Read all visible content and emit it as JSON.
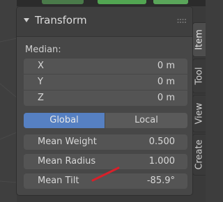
{
  "panel": {
    "title": "Transform"
  },
  "median": {
    "label": "Median:",
    "fields": [
      {
        "label": "X",
        "value": "0 m"
      },
      {
        "label": "Y",
        "value": "0 m"
      },
      {
        "label": "Z",
        "value": "0 m"
      }
    ]
  },
  "space_toggle": {
    "options": [
      "Global",
      "Local"
    ],
    "selected": "Global"
  },
  "properties": [
    {
      "label": "Mean Weight",
      "value": "0.500"
    },
    {
      "label": "Mean Radius",
      "value": "1.000"
    },
    {
      "label": "Mean Tilt",
      "value": "-85.9°"
    }
  ],
  "tabs": [
    {
      "label": "Item",
      "active": true
    },
    {
      "label": "Tool",
      "active": false
    },
    {
      "label": "View",
      "active": false
    },
    {
      "label": "Create",
      "active": false
    }
  ],
  "colors": {
    "accent": "#5680c2",
    "annotation_stroke": "#d8202a"
  },
  "icons": {
    "collapse": "chevron-down-icon",
    "drag": "drag-handle-icon"
  }
}
